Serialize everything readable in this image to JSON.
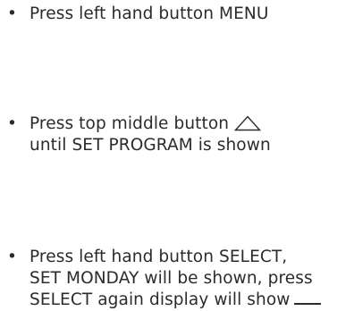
{
  "instructions": [
    {
      "bullet": "•",
      "lines": [
        "Press left hand button MENU"
      ]
    },
    {
      "bullet": "•",
      "lines": [
        "Press top middle button",
        "until SET PROGRAM is shown"
      ],
      "icon": "up-triangle-icon"
    },
    {
      "bullet": "•",
      "lines": [
        "Press left hand button SELECT,",
        "SET MONDAY will be shown, press",
        "SELECT again display will show"
      ],
      "trailing": "blank-line"
    }
  ],
  "colors": {
    "text": "#2b2b2b",
    "background": "#ffffff"
  }
}
